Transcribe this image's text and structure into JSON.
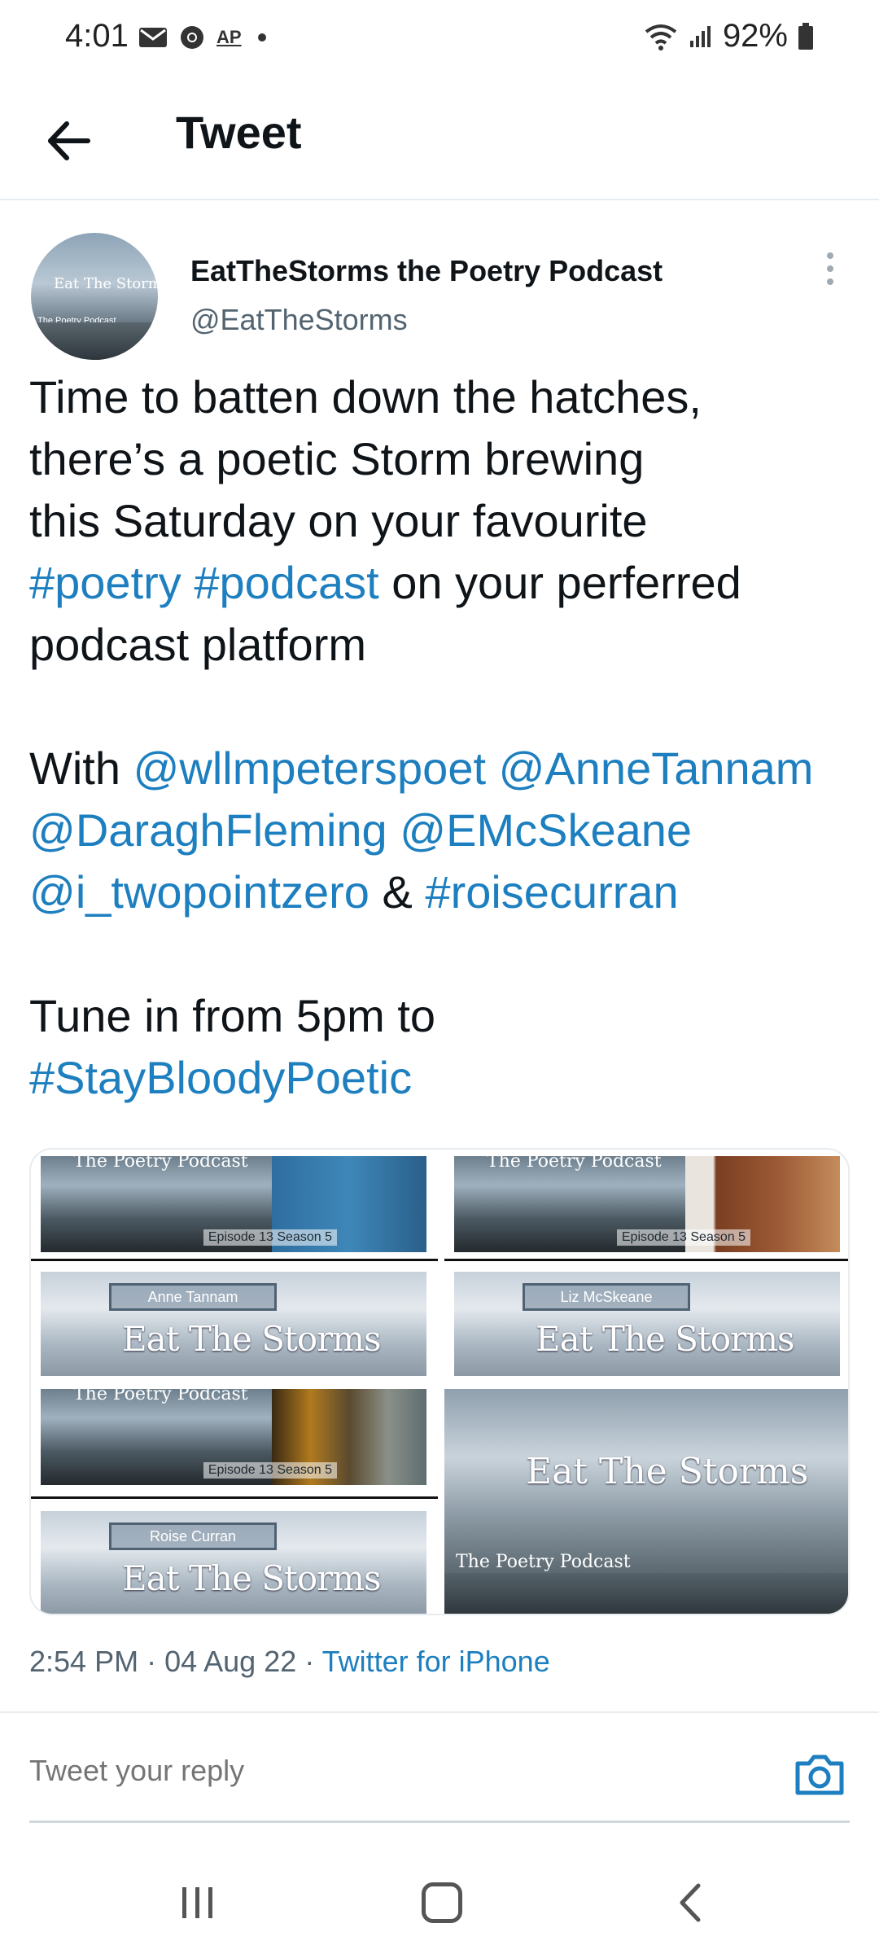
{
  "status_bar": {
    "time": "4:01",
    "battery": "92%",
    "left_icons": [
      "mail-icon",
      "chrome-icon",
      "ap-icon",
      "dot-icon"
    ],
    "ap_label": "AP"
  },
  "header": {
    "title": "Tweet"
  },
  "tweet": {
    "author_name": "EatTheStorms the Poetry Podcast",
    "author_handle": "@EatTheStorms",
    "avatar_title": "Eat The Storms",
    "avatar_subtitle": "The Poetry Podcast",
    "text_parts": {
      "l1": "Time to batten down the hatches,",
      "l2": "there’s a poetic Storm brewing",
      "l3": "this Saturday on your favourite",
      "l4_tag1": "#poetry",
      "l4_tag2": "#podcast",
      "l4_rest": " on your perferred",
      "l5": "podcast platform",
      "l6_with": "With ",
      "l6_m1": "@wllmpeterspoet",
      "l6_m2": "@AnneTannam",
      "l7_m1": "@DaraghFleming",
      "l7_m2": "@EMcSkeane",
      "l8_m1": "@i_twopointzero",
      "l8_amp": " & ",
      "l8_tag": "#roisecurran",
      "l9": "Tune in from 5pm to",
      "l10_tag": "#StayBloodyPoetic"
    },
    "media": {
      "strip_label": "The Poetry Podcast",
      "episode_label": "Episode 13 Season 5",
      "banner_title": "Eat The Storms",
      "tile_a_name": "Anne Tannam",
      "tile_b_name": "Liz McSkeane",
      "tile_c_name": "Roise Curran",
      "tile_d_title": "Eat The Storms",
      "tile_d_subtitle": "The Poetry Podcast"
    },
    "time": "2:54 PM",
    "date": "04 Aug 22",
    "separator": " · ",
    "source": "Twitter for iPhone"
  },
  "reply": {
    "placeholder": "Tweet your reply"
  },
  "colors": {
    "link": "#1d7fbf",
    "text": "#0f1419",
    "muted": "#536471"
  }
}
